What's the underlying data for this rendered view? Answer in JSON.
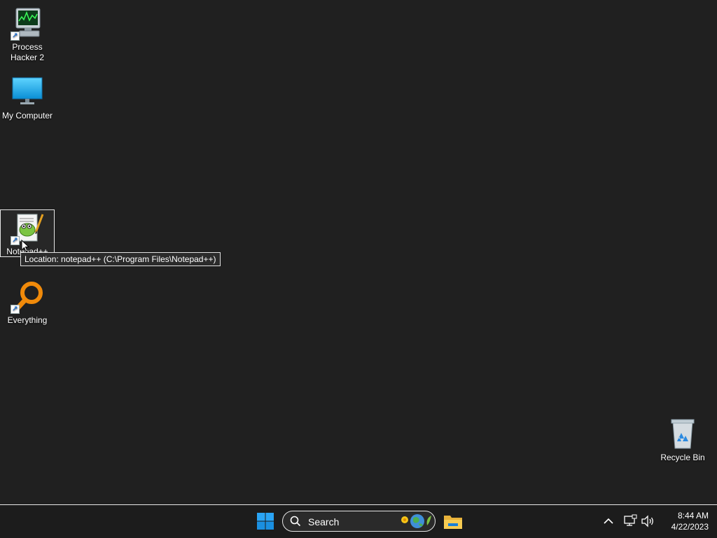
{
  "desktop": {
    "icons": [
      {
        "label_line1": "Process",
        "label_line2": "Hacker 2"
      },
      {
        "label": "My Computer"
      },
      {
        "label": "Notepad++"
      },
      {
        "label": "Everything"
      },
      {
        "label": "Recycle Bin"
      }
    ],
    "tooltip": "Location: notepad++ (C:\\Program Files\\Notepad++)"
  },
  "taskbar": {
    "search_placeholder": "Search",
    "time": "8:44 AM",
    "date": "4/22/2023"
  },
  "icons": [
    "process-hacker-icon",
    "monitor-icon",
    "notepad-plus-plus-icon",
    "magnifier-icon",
    "recycle-bin-icon",
    "windows-logo-icon",
    "search-icon",
    "file-explorer-icon",
    "chevron-up-icon",
    "network-icon",
    "volume-icon"
  ],
  "colors": {
    "desktop_bg": "#202020",
    "taskbar_bg": "#1c1c1c",
    "accent": "#0078d4"
  }
}
